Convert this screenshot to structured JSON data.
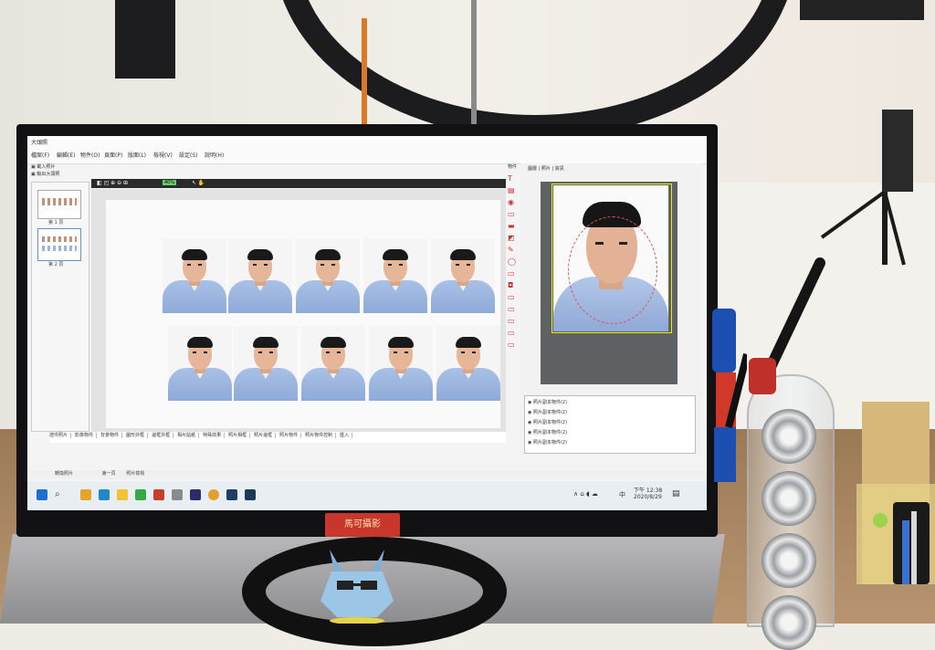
{
  "app": {
    "title": "大頭照",
    "menu": [
      "檔案(F)",
      "編輯(E)",
      "物件(O)",
      "頁面(P)",
      "版面(L)",
      "檢視(V)",
      "設定(S)",
      "說明(H)"
    ],
    "left_actions": [
      "載入照片",
      "輸出大頭照"
    ],
    "pages": [
      "第 1 頁",
      "第 2 頁"
    ],
    "zoom": "40%",
    "ruler_marks": [
      "1200",
      "1400",
      "1600",
      "1800",
      "11000",
      "11200",
      "11400"
    ],
    "right_tabs": [
      "圖層",
      "照片",
      "資訊"
    ],
    "side_label": "物件",
    "layer_items": [
      "照片副本物件(2)",
      "照片副本物件(2)",
      "照片副本物件(2)",
      "照片副本物件(2)",
      "照片副本物件(2)"
    ],
    "bottom_tabs": [
      "證件照片",
      "影像物件",
      "背景物件",
      "圖形外框",
      "邊框外框",
      "相片貼紙",
      "特殊效果",
      "照片相框",
      "照片邊框",
      "照片物件",
      "照片物件控制",
      "匯入"
    ],
    "status_items": [
      "轉換照片",
      "第一頁",
      "照片檢視"
    ]
  },
  "taskbar": {
    "time": "下午 12:38",
    "date": "2020/8/29",
    "ime": "中"
  },
  "sign_text": "馬可攝影",
  "colors": {
    "shirt": "#9bb5e0",
    "monitor_bezel": "#121214",
    "sign_bg": "#c8372c",
    "taskbar": "#e9eef2"
  }
}
